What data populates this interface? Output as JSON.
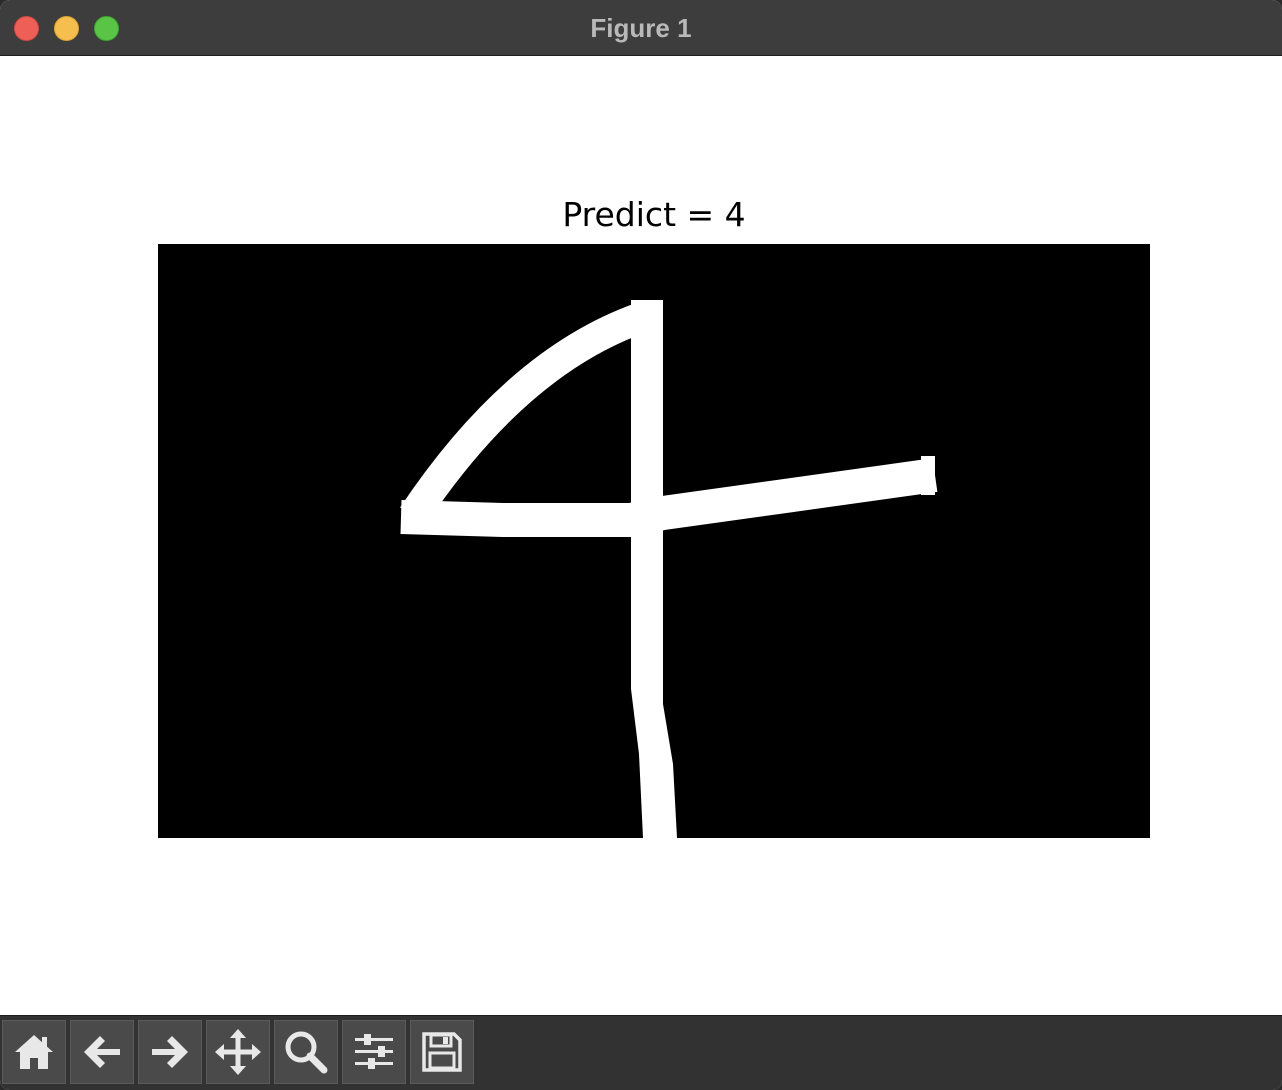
{
  "window": {
    "title": "Figure 1"
  },
  "figure": {
    "plot_title": "Predict = 4",
    "image_content": "handwritten digit 4 (white strokes on black)"
  },
  "toolbar": {
    "buttons": [
      {
        "icon": "home-icon",
        "action": "home"
      },
      {
        "icon": "arrow-left-icon",
        "action": "back"
      },
      {
        "icon": "arrow-right-icon",
        "action": "forward"
      },
      {
        "icon": "move-icon",
        "action": "pan"
      },
      {
        "icon": "zoom-icon",
        "action": "zoom"
      },
      {
        "icon": "sliders-icon",
        "action": "configure-subplots"
      },
      {
        "icon": "save-icon",
        "action": "save"
      }
    ]
  },
  "colors": {
    "titlebar": "#3c3d3c",
    "toolbar": "#323232",
    "button": "#4a4a4a",
    "icon": "#e8e8e8",
    "close": "#ee5f57",
    "minimize": "#f5be4f",
    "maximize": "#5ac446"
  }
}
